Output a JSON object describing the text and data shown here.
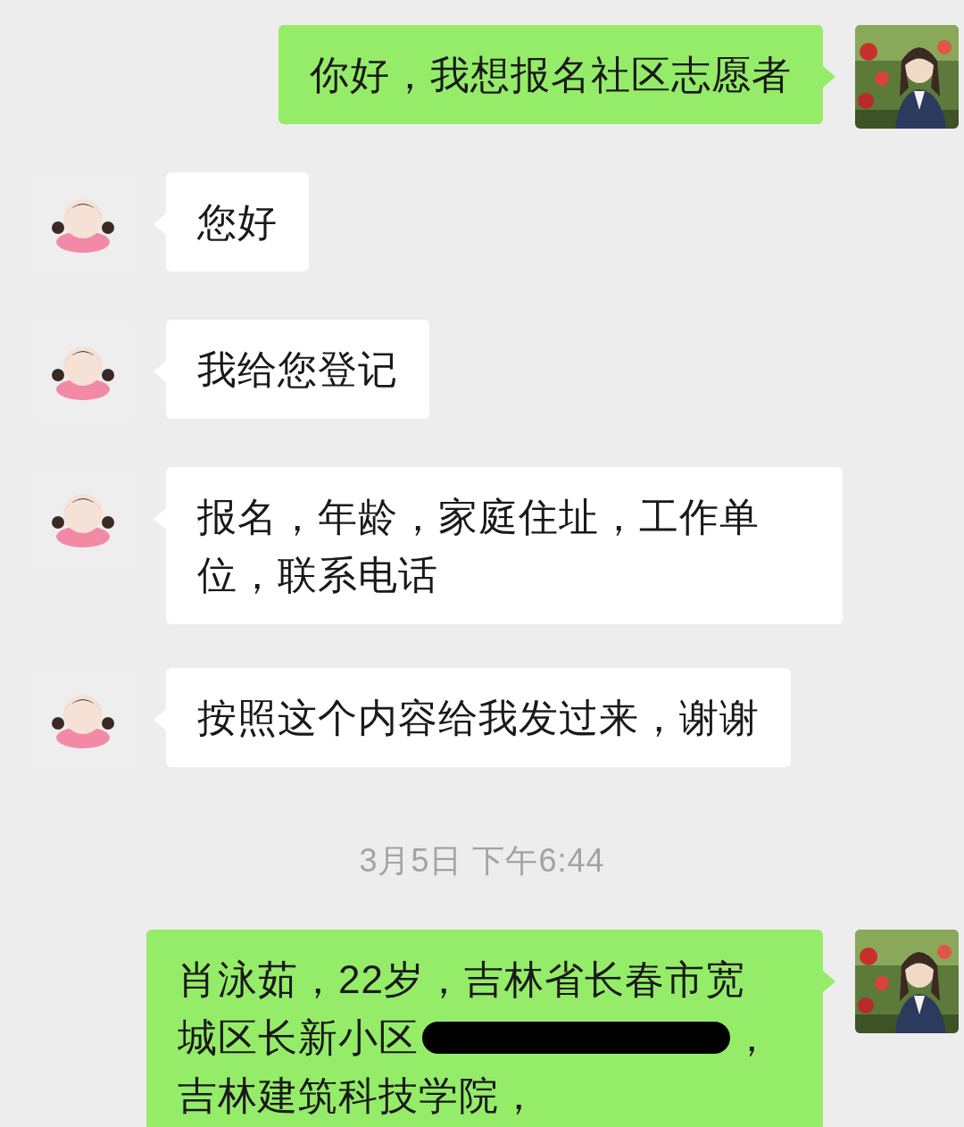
{
  "messages": [
    {
      "kind": "text",
      "outgoing": true,
      "lines": [
        [
          {
            "kind": "text",
            "text": "你好，我想报名社区志愿者"
          }
        ]
      ]
    },
    {
      "kind": "text",
      "outgoing": false,
      "lines": [
        [
          {
            "kind": "text",
            "text": "您好"
          }
        ]
      ]
    },
    {
      "kind": "text",
      "outgoing": false,
      "lines": [
        [
          {
            "kind": "text",
            "text": "我给您登记"
          }
        ]
      ]
    },
    {
      "kind": "text",
      "outgoing": false,
      "lines": [
        [
          {
            "kind": "text",
            "text": "报名，年龄，家庭住址，工作单"
          }
        ],
        [
          {
            "kind": "text",
            "text": "位，联系电话"
          }
        ]
      ]
    },
    {
      "kind": "text",
      "outgoing": false,
      "lines": [
        [
          {
            "kind": "text",
            "text": "按照这个内容给我发过来，谢谢"
          }
        ]
      ]
    },
    {
      "kind": "timestamp",
      "text": "3月5日 下午6:44"
    },
    {
      "kind": "text",
      "outgoing": true,
      "lines": [
        [
          {
            "kind": "text",
            "text": "肖泳茹，22岁，吉林省长春市宽"
          }
        ],
        [
          {
            "kind": "text",
            "text": "城区长新小区"
          },
          {
            "kind": "redacted"
          },
          {
            "kind": "text",
            "text": "，"
          }
        ],
        [
          {
            "kind": "text",
            "text": "吉林建筑科技学院，"
          }
        ]
      ]
    }
  ]
}
